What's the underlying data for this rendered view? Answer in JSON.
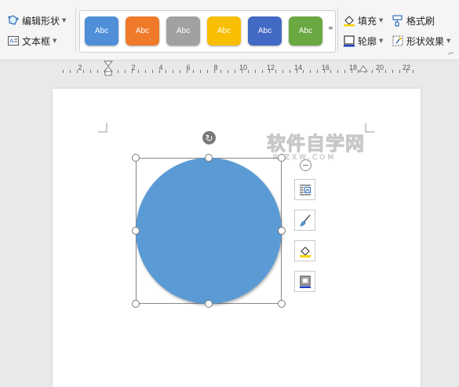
{
  "ribbon": {
    "edit_shape": "编辑形状",
    "text_box": "文本框",
    "fill": "填充",
    "outline": "轮廓",
    "format_painter": "格式刷",
    "shape_effects": "形状效果"
  },
  "style_gallery": {
    "label": "Abc",
    "colors": [
      "#4f8fd8",
      "#ef7a2a",
      "#a1a1a1",
      "#f7bf00",
      "#4269c4",
      "#6aa842"
    ]
  },
  "ruler": {
    "numbers": [
      "2",
      "2",
      "4",
      "6",
      "8",
      "10",
      "12",
      "14",
      "16",
      "18",
      "20",
      "22"
    ]
  },
  "watermark": {
    "main": "软件自学网",
    "sub": "RJZXW.COM"
  },
  "shape": {
    "fill_color": "#5b9bd5"
  }
}
